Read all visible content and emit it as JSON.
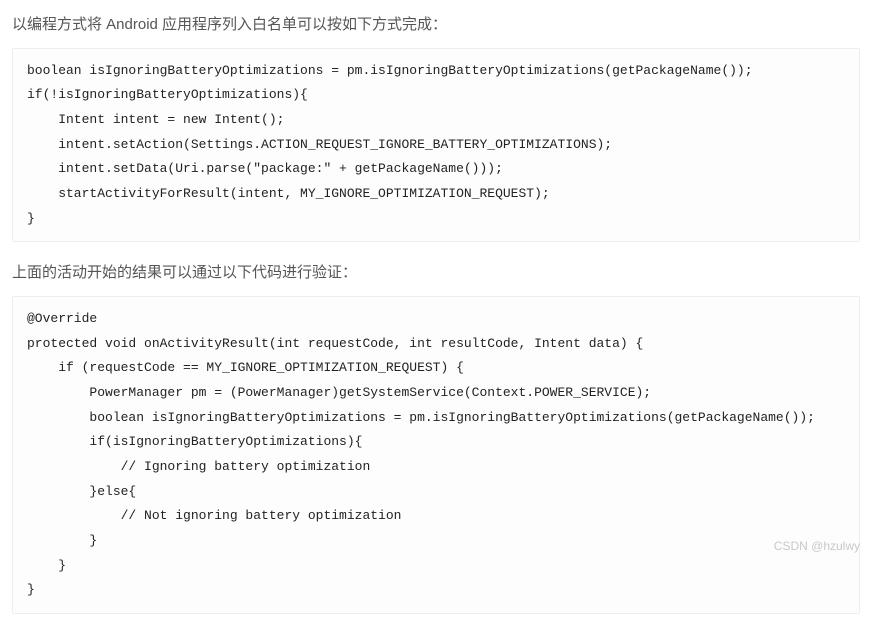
{
  "paragraphs": {
    "intro": "以编程方式将 Android 应用程序列入白名单可以按如下方式完成：",
    "verify": "上面的活动开始的结果可以通过以下代码进行验证："
  },
  "code": {
    "block1": "boolean isIgnoringBatteryOptimizations = pm.isIgnoringBatteryOptimizations(getPackageName());\nif(!isIgnoringBatteryOptimizations){\n    Intent intent = new Intent();\n    intent.setAction(Settings.ACTION_REQUEST_IGNORE_BATTERY_OPTIMIZATIONS);\n    intent.setData(Uri.parse(\"package:\" + getPackageName()));\n    startActivityForResult(intent, MY_IGNORE_OPTIMIZATION_REQUEST);\n}",
    "block2": "@Override\nprotected void onActivityResult(int requestCode, int resultCode, Intent data) {\n    if (requestCode == MY_IGNORE_OPTIMIZATION_REQUEST) {\n        PowerManager pm = (PowerManager)getSystemService(Context.POWER_SERVICE);\n        boolean isIgnoringBatteryOptimizations = pm.isIgnoringBatteryOptimizations(getPackageName());\n        if(isIgnoringBatteryOptimizations){\n            // Ignoring battery optimization\n        }else{\n            // Not ignoring battery optimization\n        }\n    }\n}"
  },
  "watermark": "CSDN @hzulwy"
}
